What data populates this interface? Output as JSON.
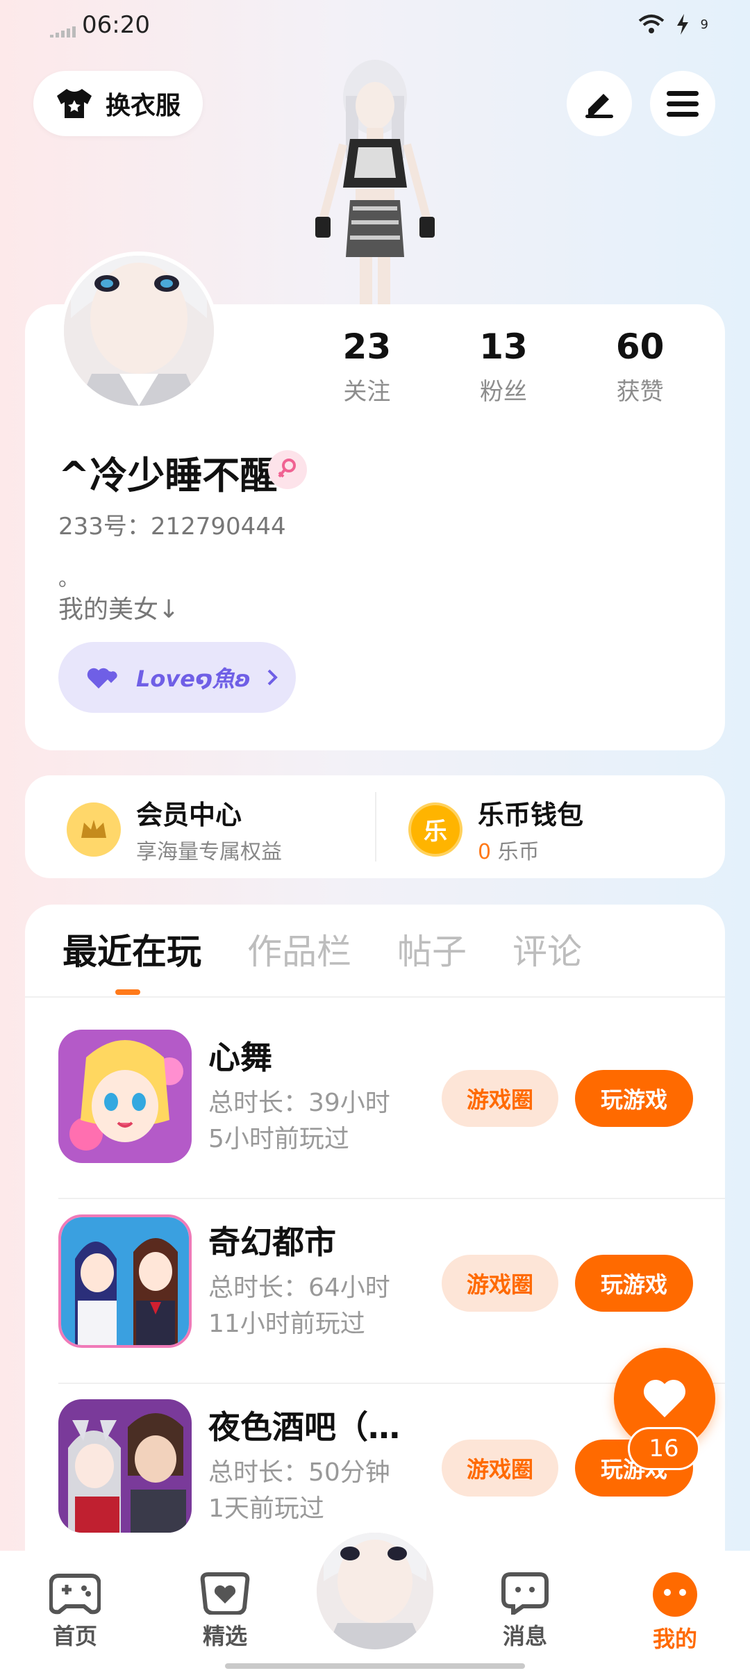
{
  "status_bar": {
    "time": "06:20",
    "battery": "9"
  },
  "header": {
    "outfit_label": "换衣服"
  },
  "profile": {
    "stats": [
      {
        "num": "23",
        "label": "关注"
      },
      {
        "num": "13",
        "label": "粉丝"
      },
      {
        "num": "60",
        "label": "获赞"
      }
    ],
    "nickname": "^冷少睡不醒",
    "uid": "233号：212790444",
    "bio_line1": "。",
    "bio_line2": "我的美女↓",
    "tag": "Love໑魚ʚ"
  },
  "member": {
    "title": "会员中心",
    "subtitle": "享海量专属权益"
  },
  "wallet": {
    "title": "乐币钱包",
    "amount": "0",
    "unit": "乐币",
    "coin_char": "乐"
  },
  "tabs": [
    "最近在玩",
    "作品栏",
    "帖子",
    "评论"
  ],
  "games": [
    {
      "name": "心舞",
      "duration": "总时长：39小时",
      "last_played": "5小时前玩过",
      "circle_label": "游戏圈",
      "play_label": "玩游戏"
    },
    {
      "name": "奇幻都市",
      "duration": "总时长：64小时",
      "last_played": "11小时前玩过",
      "circle_label": "游戏圈",
      "play_label": "玩游戏"
    },
    {
      "name": "夜色酒吧（…",
      "duration": "总时长：50分钟",
      "last_played": "1天前玩过",
      "circle_label": "游戏圈",
      "play_label": "玩游戏"
    }
  ],
  "fab": {
    "count": "16"
  },
  "nav": [
    {
      "label": "首页",
      "icon": "gamepad-icon"
    },
    {
      "label": "精选",
      "icon": "heart-box-icon"
    },
    {
      "label": "消息",
      "icon": "chat-icon"
    },
    {
      "label": "我的",
      "icon": "face-icon"
    }
  ],
  "colors": {
    "accent": "#ff6a00",
    "tag": "#6f5fe6"
  }
}
